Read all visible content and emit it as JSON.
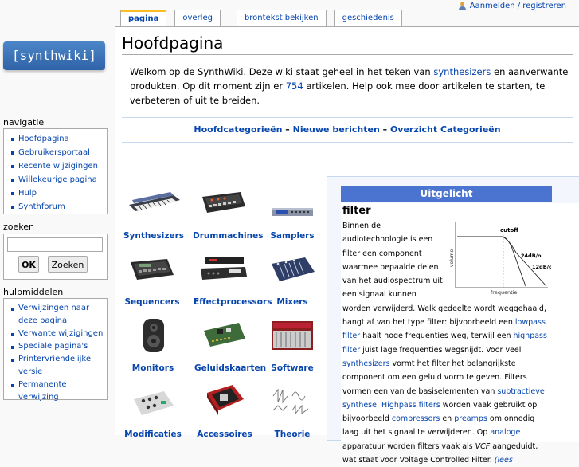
{
  "user": {
    "login_label": "Aanmelden / registreren"
  },
  "tabs": [
    {
      "label": "pagina"
    },
    {
      "label": "overleg"
    },
    {
      "label": "brontekst bekijken"
    },
    {
      "label": "geschiedenis"
    }
  ],
  "logo": {
    "text": "[synthwiki]"
  },
  "navigation": {
    "title": "navigatie",
    "items": [
      "Hoofdpagina",
      "Gebruikersportaal",
      "Recente wijzigingen",
      "Willekeurige pagina",
      "Hulp",
      "Synthforum"
    ]
  },
  "search": {
    "title": "zoeken",
    "value": "",
    "ok_label": "OK",
    "go_label": "Zoeken"
  },
  "tools": {
    "title": "hulpmiddelen",
    "items": [
      "Verwijzingen naar deze pagina",
      "Verwante wijzigingen",
      "Speciale pagina's",
      "Printervriendelijke versie",
      "Permanente verwijzing"
    ]
  },
  "page": {
    "title": "Hoofdpagina",
    "intro_pre": "Welkom op de SynthWiki. Deze wiki staat geheel in het teken van ",
    "intro_link1": "synthesizers",
    "intro_mid": " en aanverwante produkten. Op dit moment zijn er ",
    "intro_count": "754",
    "intro_post": " artikelen. Help ook mee door artikelen te starten, te verbeteren of uit te breiden.",
    "cat_links": [
      "Hoofdcategorieën",
      "Nieuwe berichten",
      "Overzicht Categorieën"
    ],
    "cat_sep": " – "
  },
  "categories": [
    "Synthesizers",
    "Drummachines",
    "Samplers",
    "Sequencers",
    "Effectprocessors",
    "Mixers",
    "Monitors",
    "Geluidskaarten",
    "Software",
    "Modificaties",
    "Accessoires",
    "Theorie"
  ],
  "featured": {
    "header": "Uitgelicht",
    "title": "filter",
    "figure": {
      "cutoff": "cutoff",
      "db24": "24dB/o",
      "db12": "12dB/o",
      "xlabel": "frequentie",
      "ylabel": "volume"
    },
    "t1": "Binnen de audiotechnologie is een filter een component waarmee bepaalde delen van het audiospectrum uit een signaal kunnen worden verwijderd. Welk gedeelte wordt weggehaald, hangt af van het type filter: bijvoorbeeld een ",
    "l1": "lowpass filter",
    "t2": " haalt hoge frequenties weg, terwijl een ",
    "l2": "highpass filter",
    "t3": " juist lage frequenties wegsnijdt. Voor veel ",
    "l3": "synthesizers",
    "t4": " vormt het filter het belangrijkste component om een geluid vorm te geven. Filters vormen een van de basiselementen van ",
    "l4": "subtractieve synthese",
    "t5": ". ",
    "l5": "Highpass filters",
    "t6": " worden vaak gebruikt op bijvoorbeeld ",
    "l6": "compressors",
    "t7": " en ",
    "l7": "preamps",
    "t8": " om onnodig laag uit het signaal te verwijderen. Op ",
    "l8": "analoge",
    "t9": " apparatuur worden filters vaak als ",
    "t9i": "VCF",
    "t10": " aangeduidt, wat staat voor Voltage Controlled Filter. ",
    "l9": "(lees"
  }
}
